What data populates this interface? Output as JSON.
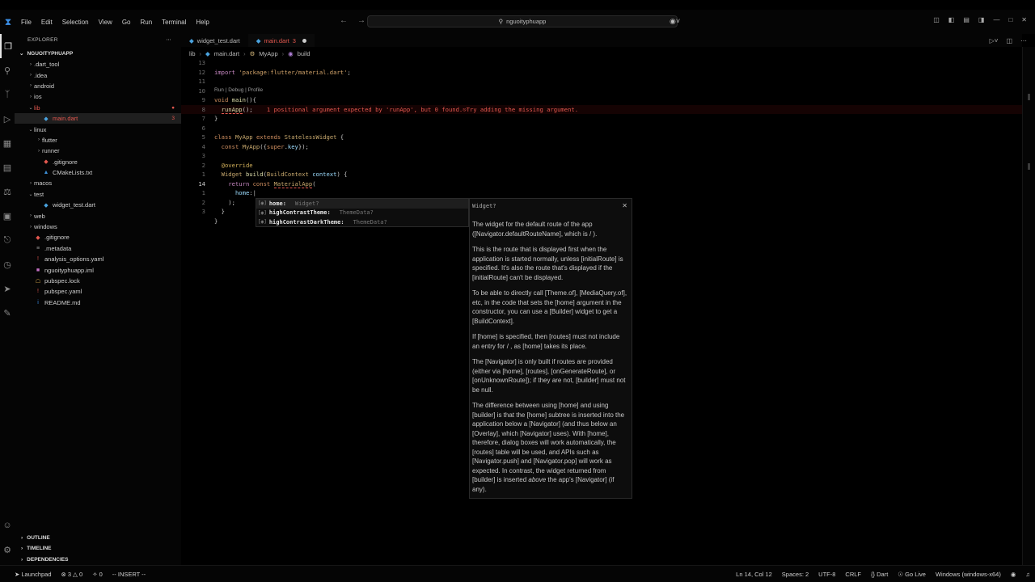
{
  "titlebar": {
    "menu": [
      "File",
      "Edit",
      "Selection",
      "View",
      "Go",
      "Run",
      "Terminal",
      "Help"
    ],
    "search": "nguoityphuapp"
  },
  "sidebar": {
    "header": "EXPLORER",
    "root": "NGUOITYPHUAPP",
    "items": [
      {
        "label": ".dart_tool",
        "depth": 0,
        "type": "folder",
        "open": false
      },
      {
        "label": ".idea",
        "depth": 0,
        "type": "folder",
        "open": false
      },
      {
        "label": "android",
        "depth": 0,
        "type": "folder",
        "open": false
      },
      {
        "label": "ios",
        "depth": 0,
        "type": "folder",
        "open": false
      },
      {
        "label": "lib",
        "depth": 0,
        "type": "folder",
        "open": true,
        "error": true
      },
      {
        "label": "main.dart",
        "depth": 1,
        "type": "dart",
        "error": true,
        "badge": "3",
        "selected": true
      },
      {
        "label": "linux",
        "depth": 0,
        "type": "folder",
        "open": true
      },
      {
        "label": "flutter",
        "depth": 1,
        "type": "folder",
        "open": false
      },
      {
        "label": "runner",
        "depth": 1,
        "type": "folder",
        "open": false
      },
      {
        "label": ".gitignore",
        "depth": 1,
        "type": "git"
      },
      {
        "label": "CMakeLists.txt",
        "depth": 1,
        "type": "cmake"
      },
      {
        "label": "macos",
        "depth": 0,
        "type": "folder",
        "open": false
      },
      {
        "label": "test",
        "depth": 0,
        "type": "folder",
        "open": true
      },
      {
        "label": "widget_test.dart",
        "depth": 1,
        "type": "dart"
      },
      {
        "label": "web",
        "depth": 0,
        "type": "folder",
        "open": false
      },
      {
        "label": "windows",
        "depth": 0,
        "type": "folder",
        "open": false
      },
      {
        "label": ".gitignore",
        "depth": 0,
        "type": "git"
      },
      {
        "label": ".metadata",
        "depth": 0,
        "type": "meta"
      },
      {
        "label": "analysis_options.yaml",
        "depth": 0,
        "type": "yaml-red"
      },
      {
        "label": "nguoityphuapp.iml",
        "depth": 0,
        "type": "iml"
      },
      {
        "label": "pubspec.lock",
        "depth": 0,
        "type": "lock"
      },
      {
        "label": "pubspec.yaml",
        "depth": 0,
        "type": "yaml-red"
      },
      {
        "label": "README.md",
        "depth": 0,
        "type": "info"
      }
    ],
    "sections": [
      "OUTLINE",
      "TIMELINE",
      "DEPENDENCIES"
    ]
  },
  "tabs": [
    {
      "label": "widget_test.dart",
      "active": false
    },
    {
      "label": "main.dart",
      "badge": "3",
      "active": true,
      "error": true
    }
  ],
  "breadcrumbs": [
    "lib",
    "main.dart",
    "MyApp",
    "build"
  ],
  "editor": {
    "line_numbers": [
      "13",
      "12",
      "11",
      "10",
      "9",
      "8",
      "7",
      "6",
      "5",
      "4",
      "3",
      "2",
      "1",
      "14",
      "1",
      "2",
      "3"
    ],
    "codelens": "Run | Debug | Profile",
    "error_message": "1 positional argument expected by 'runApp', but 0 found.",
    "error_hint": "Try adding the missing argument."
  },
  "suggest": [
    {
      "label": "home:",
      "type": "Widget?"
    },
    {
      "label": "highContrastTheme:",
      "type": "ThemeData?"
    },
    {
      "label": "highContrastDarkTheme:",
      "type": "ThemeData?"
    }
  ],
  "docs": {
    "signature": "Widget?",
    "paragraphs": [
      "The widget for the default route of the app ([Navigator.defaultRouteName], which is  / ).",
      "This is the route that is displayed first when the application is started normally, unless [initialRoute] is specified. It's also the route that's displayed if the [initialRoute] can't be displayed.",
      "To be able to directly call [Theme.of], [MediaQuery.of], etc, in the code that sets the [home] argument in the constructor, you can use a [Builder] widget to get a [BuildContext].",
      "If [home] is specified, then [routes] must not include an entry for  / , as [home] takes its place.",
      "The [Navigator] is only built if routes are provided (either via [home], [routes], [onGenerateRoute], or [onUnknownRoute]); if they are not, [builder] must not be null."
    ],
    "last_para": {
      "a": "The difference between using [home] and using [builder] is that the [home] subtree is inserted into the application below a [Navigator] (and thus below an [Overlay], which [Navigator] uses). With [home], therefore, dialog boxes will work automatically, the [routes] table will be used, and APIs such as [Navigator.push] and [Navigator.pop] will work as expected. In contrast, the widget returned from [builder] is inserted",
      "em": "above",
      "b": "the app's [Navigator] (if any)."
    }
  },
  "statusbar": {
    "launchpad": "Launchpad",
    "errors": "3",
    "warnings": "0",
    "ports": "0",
    "mode": "-- INSERT --",
    "position": "Ln 14, Col 12",
    "spaces": "Spaces: 2",
    "encoding": "UTF-8",
    "eol": "CRLF",
    "language": "Dart",
    "golive": "Go Live",
    "platform": "Windows (windows-x64)"
  }
}
